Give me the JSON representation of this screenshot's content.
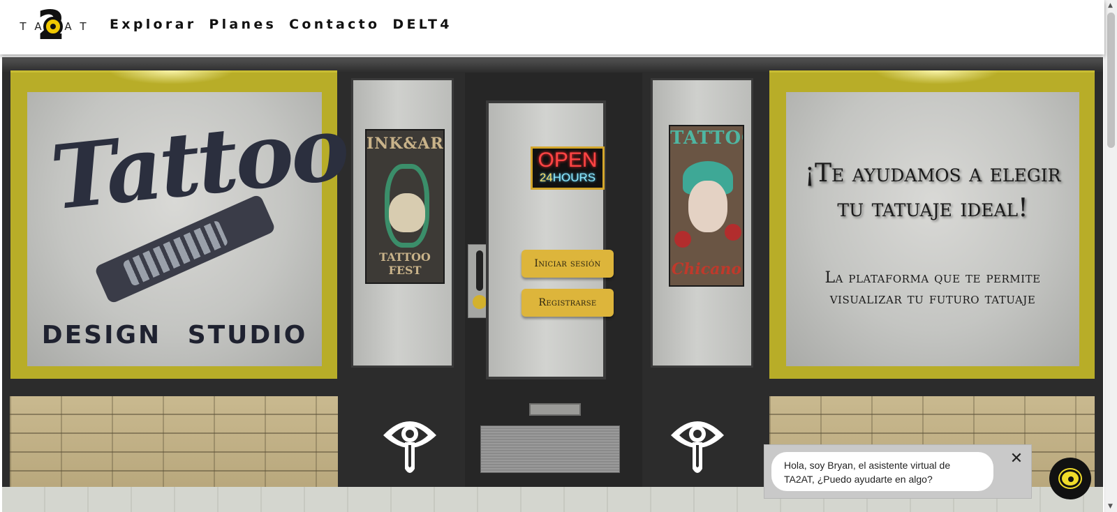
{
  "header": {
    "logo": {
      "letters": [
        "T",
        "A",
        "",
        "A",
        "T"
      ],
      "number": "2"
    },
    "nav": [
      "Explorar",
      "Planes",
      "Contacto",
      "DELT4"
    ]
  },
  "storefront": {
    "left_window": {
      "script_word": "Tattoo",
      "caption": "DESIGN STUDIO"
    },
    "poster_left": {
      "title": "INK&ART",
      "subtitle": "TATTOO FEST"
    },
    "poster_right": {
      "title": "TATTOO",
      "script": "Chicano"
    },
    "open_sign": {
      "top": "OPEN",
      "number": "24",
      "unit": "HOURS"
    },
    "buttons": {
      "login": "Iniciar sesión",
      "register": "Registrarse"
    },
    "hero": {
      "title_line1": "¡Te ayudamos a elegir",
      "title_line2": "tu tatuaje ideal!",
      "subtitle_line1": "La plataforma que te permite",
      "subtitle_line2": "visualizar tu futuro tatuaje"
    }
  },
  "chat": {
    "message": "Hola, soy Bryan, el asistente virtual de TA2AT, ¿Puedo ayudarte en algo?",
    "close_symbol": "✕"
  },
  "colors": {
    "gold_frame": "#b8ad28",
    "button": "#ddb53b",
    "dark": "#2c2c2c"
  }
}
